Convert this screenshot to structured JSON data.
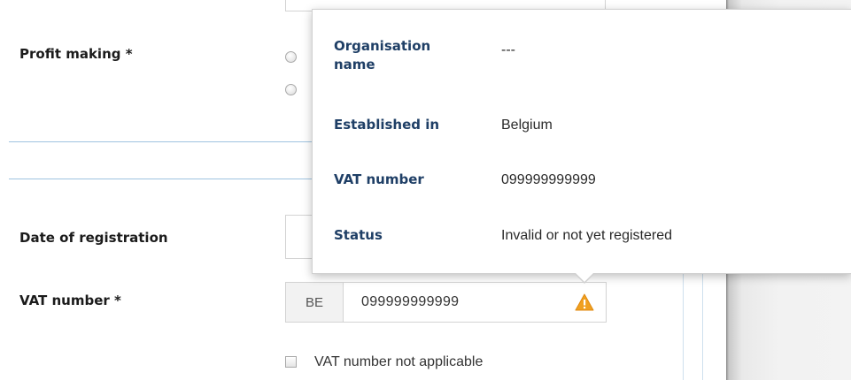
{
  "form": {
    "profit_making_label": "Profit making *",
    "date_of_registration_label": "Date of registration",
    "vat_number_label": "VAT number *",
    "vat_prefix": "BE",
    "vat_value": "099999999999",
    "vat_not_applicable_label": "VAT number not applicable"
  },
  "popover": {
    "rows": [
      {
        "key": "Organisation name",
        "value": "---"
      },
      {
        "key": "Established in",
        "value": "Belgium"
      },
      {
        "key": "VAT number",
        "value": "099999999999"
      },
      {
        "key": "Status",
        "value": "Invalid or not yet registered"
      }
    ]
  },
  "colors": {
    "label_text": "#1b1b1b",
    "popover_key_text": "#1f3f66",
    "warning_icon": "#f0a020",
    "divider": "#9fc3e0"
  },
  "icons": {
    "warning": "warning-triangle-icon"
  }
}
